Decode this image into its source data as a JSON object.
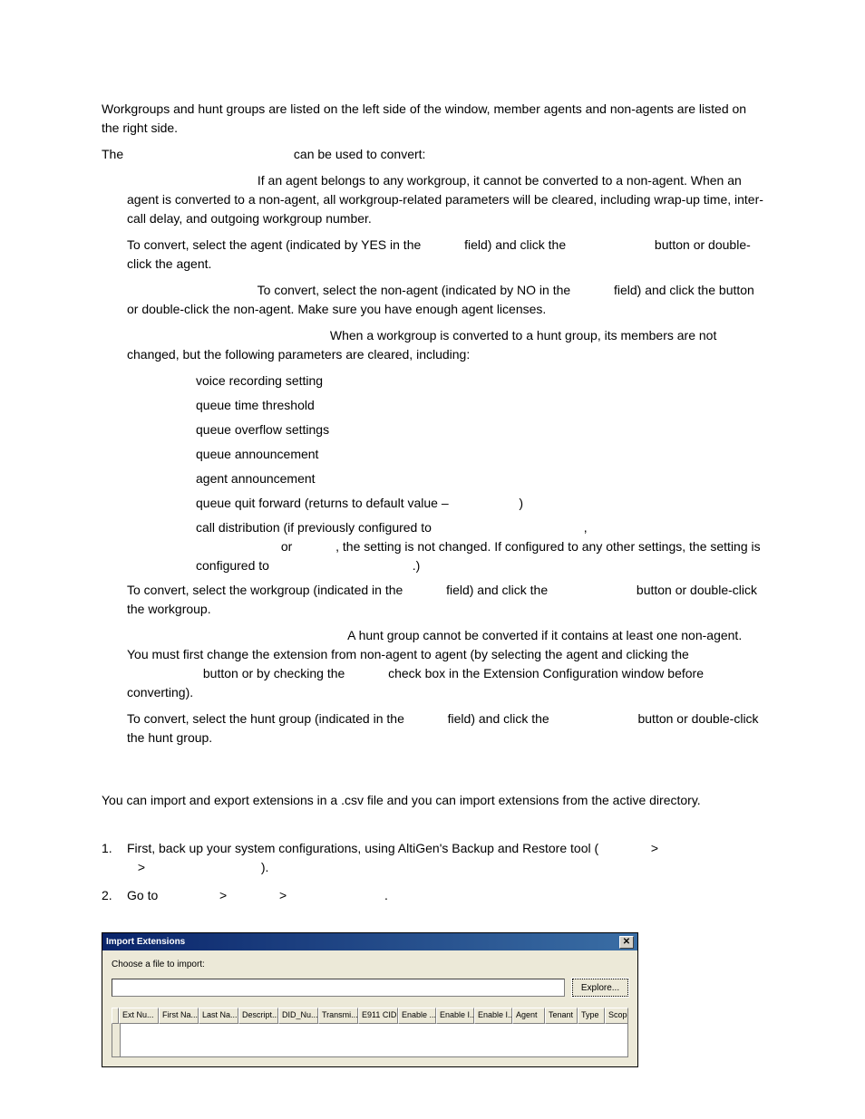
{
  "intro_p1": "Workgroups and hunt groups are listed on the left side of the window, member agents and non-agents are listed on the right side.",
  "intro_p2_a": "The ",
  "intro_p2_b": " can be used to convert:",
  "agent2non_a": "If an agent belongs to any workgroup, it cannot be converted to a non-agent. When an agent is converted to a non-agent, all workgroup-related parameters will be cleared, including wrap-up time, inter-call delay, and outgoing workgroup number.",
  "agent2non_b_a": "To convert, select the agent (indicated by YES in the ",
  "agent2non_b_b": " field) and click the ",
  "agent2non_b_c": " button or double-click the agent.",
  "non2agent_a": "To convert, select the non-agent (indicated by NO in the ",
  "non2agent_b": " field) and click the ",
  "non2agent_c": " button or double-click the non-agent. Make sure you have enough agent licenses.",
  "wg2hg_a": "When a workgroup is converted to a hunt group, its members are not changed, but the following parameters are cleared, including:",
  "bullets": {
    "b1": "voice recording setting",
    "b2": "queue time threshold",
    "b3": "queue overflow settings",
    "b4": "queue announcement",
    "b5": "agent announcement",
    "b6_a": "queue quit forward (returns to default value – ",
    "b6_b": ")",
    "b7_a": "call distribution (if previously configured to ",
    "b7_b": ", ",
    "b7_c": "or ",
    "b7_d": ", the setting is not changed. If configured to any other settings, the setting is configured to ",
    "b7_e": ".)"
  },
  "wg_convert_a": "To convert, select the workgroup (indicated in the ",
  "wg_convert_b": " field) and click the ",
  "wg_convert_c": " button or double-click the workgroup.",
  "hg2wg_a": "A hunt group cannot be converted if it contains at least one non-agent. You must first change the extension from non-agent to agent (by selecting the agent and clicking the ",
  "hg2wg_b": " button or by checking the ",
  "hg2wg_c": " check box in the Extension Configuration window before converting).",
  "hg_convert_a": "To convert, select the hunt group (indicated in the ",
  "hg_convert_b": " field) and click the ",
  "hg_convert_c": " button or double-click the hunt group.",
  "io_intro": "You can import and export extensions in a .csv file and you can import extensions from the active directory.",
  "step1_a": "First, back up your system configurations, using AltiGen's Backup and Restore tool (",
  "step1_b": " > ",
  "step1_c": " > ",
  "step1_d": ").",
  "step2_a": "Go to ",
  "step2_b": " > ",
  "step2_c": " > ",
  "step2_d": ".",
  "dialog": {
    "title": "Import Extensions",
    "choose": "Choose a file to import:",
    "explore": "Explore...",
    "close": "✕",
    "cols": [
      "Ext Nu...",
      "First Na...",
      "Last Na...",
      "Descript...",
      "DID_Nu...",
      "Transmi...",
      "E911 CID",
      "Enable ...",
      "Enable I...",
      "Enable I...",
      "Agent",
      "Tenant",
      "Type",
      "Scope"
    ]
  }
}
